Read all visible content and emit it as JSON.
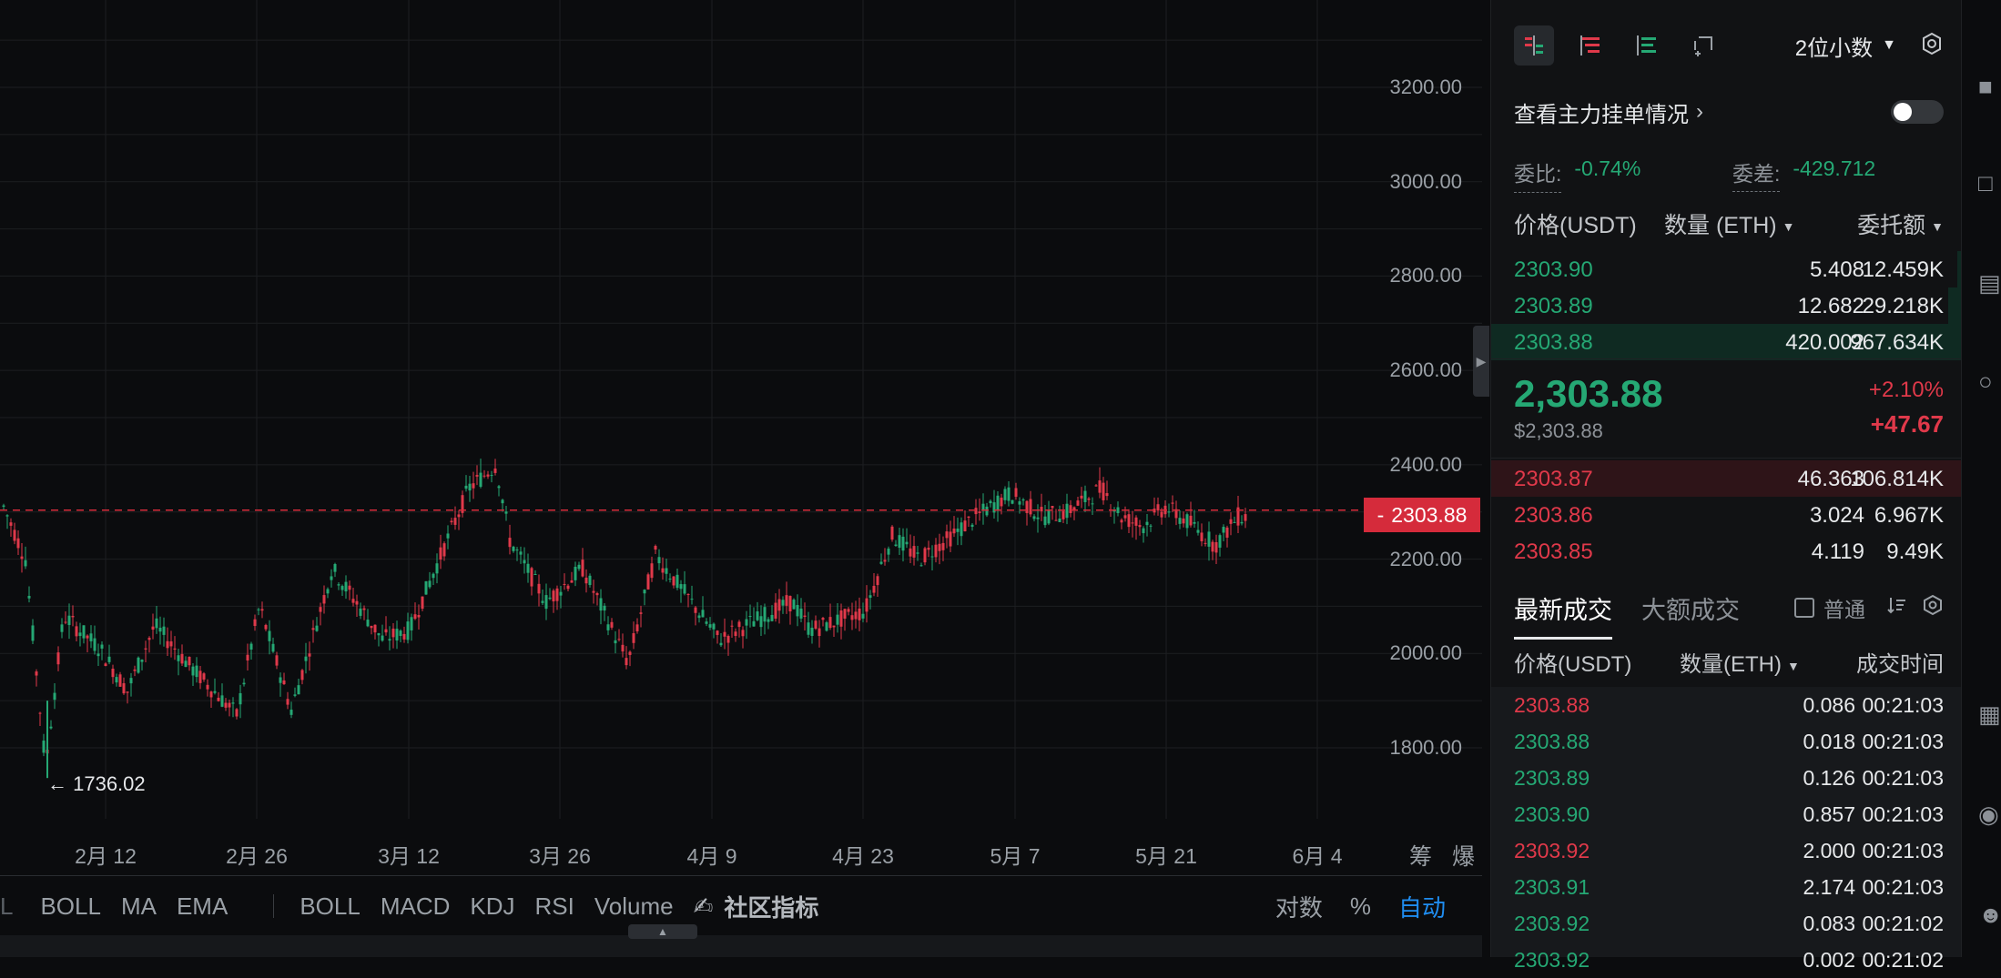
{
  "chart": {
    "price_axis": [
      "3200.00",
      "3000.00",
      "2800.00",
      "2600.00",
      "2400.00",
      "2200.00",
      "2000.00",
      "1800.00"
    ],
    "date_axis": [
      "2月 12",
      "2月 26",
      "3月 12",
      "3月 26",
      "4月 9",
      "4月 23",
      "5月 7",
      "5月 21",
      "6月 4"
    ],
    "current_price_tag": "2303.88",
    "current_price_dash": "-",
    "low_marker": "← 1736.02",
    "chip_labels": [
      "筹",
      "爆"
    ],
    "colors": {
      "up": "#25a874",
      "down": "#e0394a",
      "grid": "#1c1e21",
      "current_line": "#d52b3b"
    }
  },
  "indicators": {
    "left_edge": "L",
    "main": [
      "BOLL",
      "MA",
      "EMA"
    ],
    "sub": [
      "BOLL",
      "MACD",
      "KDJ",
      "RSI",
      "Volume"
    ],
    "community": "社区指标",
    "community_icon": "edit-icon",
    "options": [
      "对数",
      "%"
    ],
    "auto": "自动"
  },
  "orderbook": {
    "decimal_select": "2位小数",
    "main_orders_label": "查看主力挂单情况",
    "main_orders_toggle": false,
    "ratio_label": "委比:",
    "ratio_value": "-0.74%",
    "diff_label": "委差:",
    "diff_value": "-429.712",
    "headers": {
      "price": "价格(USDT)",
      "qty": "数量 (ETH)",
      "total": "委托额"
    },
    "asks": [
      {
        "price": "2303.90",
        "qty": "5.408",
        "total": "12.459K",
        "depth": 0.01
      },
      {
        "price": "2303.89",
        "qty": "12.682",
        "total": "29.218K",
        "depth": 0.03
      },
      {
        "price": "2303.88",
        "qty": "420.002",
        "total": "967.634K",
        "depth": 1.0
      }
    ],
    "last_price": "2,303.88",
    "last_price_usd": "$2,303.88",
    "change_pct": "+2.10%",
    "change_abs": "+47.67",
    "bids": [
      {
        "price": "2303.87",
        "qty": "46.363",
        "total": "106.814K",
        "depth": 1.0
      },
      {
        "price": "2303.86",
        "qty": "3.024",
        "total": "6.967K",
        "depth": 0.0
      },
      {
        "price": "2303.85",
        "qty": "4.119",
        "total": "9.49K",
        "depth": 0.0
      }
    ]
  },
  "trades": {
    "tab_latest": "最新成交",
    "tab_large": "大额成交",
    "normal_label": "普通",
    "headers": {
      "price": "价格(USDT)",
      "qty": "数量(ETH)",
      "time": "成交时间"
    },
    "rows": [
      {
        "price": "2303.88",
        "qty": "0.086",
        "time": "00:21:03",
        "side": "down"
      },
      {
        "price": "2303.88",
        "qty": "0.018",
        "time": "00:21:03",
        "side": "up"
      },
      {
        "price": "2303.89",
        "qty": "0.126",
        "time": "00:21:03",
        "side": "up"
      },
      {
        "price": "2303.90",
        "qty": "0.857",
        "time": "00:21:03",
        "side": "up"
      },
      {
        "price": "2303.92",
        "qty": "2.000",
        "time": "00:21:03",
        "side": "down"
      },
      {
        "price": "2303.91",
        "qty": "2.174",
        "time": "00:21:03",
        "side": "up"
      },
      {
        "price": "2303.92",
        "qty": "0.083",
        "time": "00:21:02",
        "side": "up"
      },
      {
        "price": "2303.92",
        "qty": "0.002",
        "time": "00:21:02",
        "side": "up"
      }
    ]
  }
}
